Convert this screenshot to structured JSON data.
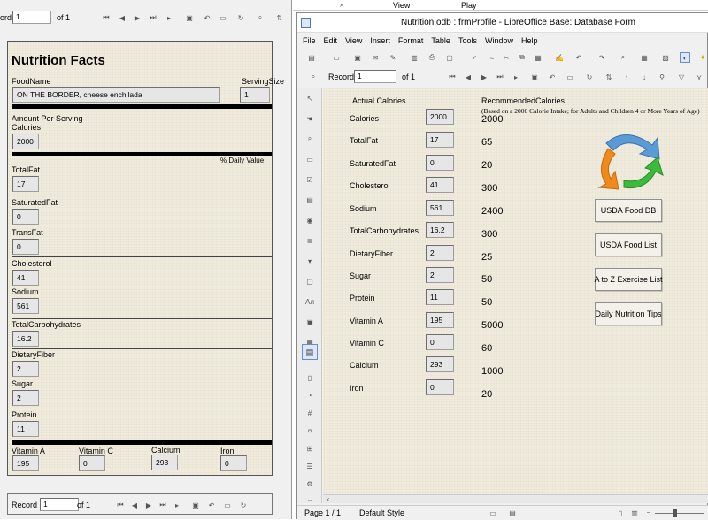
{
  "left": {
    "toolbar": {
      "record_label": "ord",
      "record_value": "1",
      "of_label": "of 1"
    },
    "form": {
      "title": "Nutrition Facts",
      "foodname_label": "FoodName",
      "foodname_value": "ON THE BORDER, cheese enchilada",
      "serving_label": "ServingSize",
      "serving_value": "1",
      "amount_label": "Amount Per Serving",
      "calories_label": "Calories",
      "calories_value": "2000",
      "daily_value_label": "% Daily Value",
      "items": [
        {
          "label": "TotalFat",
          "value": "17"
        },
        {
          "label": "SaturatedFat",
          "value": "0"
        },
        {
          "label": "TransFat",
          "value": "0"
        },
        {
          "label": "Cholesterol",
          "value": "41"
        },
        {
          "label": "Sodium",
          "value": "561"
        },
        {
          "label": "TotalCarbohydrates",
          "value": "16.2"
        },
        {
          "label": "DietaryFiber",
          "value": "2"
        },
        {
          "label": "Sugar",
          "value": "2"
        },
        {
          "label": "Protein",
          "value": "11"
        }
      ],
      "vitamins": [
        {
          "label": "Vitamin A",
          "value": "195"
        },
        {
          "label": "Vitamin C",
          "value": "0"
        },
        {
          "label": "Calcium",
          "value": "293"
        },
        {
          "label": "Iron",
          "value": "0"
        }
      ]
    },
    "bottom": {
      "record_label": "Record",
      "record_value": "1",
      "of_label": "of 1"
    }
  },
  "mid": {
    "tabs": [
      "View",
      "Play"
    ]
  },
  "window": {
    "title": "Nutrition.odb : frmProfile - LibreOffice Base: Database Form",
    "menu": [
      "File",
      "Edit",
      "View",
      "Insert",
      "Format",
      "Table",
      "Tools",
      "Window",
      "Help"
    ],
    "nav": {
      "record_label": "Record",
      "record_value": "1",
      "of_label": "of 1"
    },
    "actual_header": "Actual Calories",
    "rec_header": "RecommendedCalories",
    "rec_note": "(Based on a 2000 Calorie Intake; for Adults and Children 4 or More Years of Age)",
    "rows": [
      {
        "label": "Calories",
        "value": "2000",
        "rec": "2000"
      },
      {
        "label": "TotalFat",
        "value": "17",
        "rec": "65"
      },
      {
        "label": "SaturatedFat",
        "value": "0",
        "rec": "20"
      },
      {
        "label": "Cholesterol",
        "value": "41",
        "rec": "300"
      },
      {
        "label": "Sodium",
        "value": "561",
        "rec": "2400"
      },
      {
        "label": "TotalCarbohydrates",
        "value": "16.2",
        "rec": "300"
      },
      {
        "label": "DietaryFiber",
        "value": "2",
        "rec": "25"
      },
      {
        "label": "Sugar",
        "value": "2",
        "rec": "50"
      },
      {
        "label": "Protein",
        "value": "11",
        "rec": "50"
      },
      {
        "label": "Vitamin A",
        "value": "195",
        "rec": "5000"
      },
      {
        "label": "Vitamin C",
        "value": "0",
        "rec": "60"
      },
      {
        "label": "Calcium",
        "value": "293",
        "rec": "1000"
      },
      {
        "label": "Iron",
        "value": "0",
        "rec": "20"
      }
    ],
    "buttons": [
      "USDA Food DB",
      "USDA Food List",
      "A to Z Exercise List",
      "Daily Nutrition Tips"
    ],
    "status": {
      "page": "Page 1 / 1",
      "style": "Default Style"
    }
  }
}
